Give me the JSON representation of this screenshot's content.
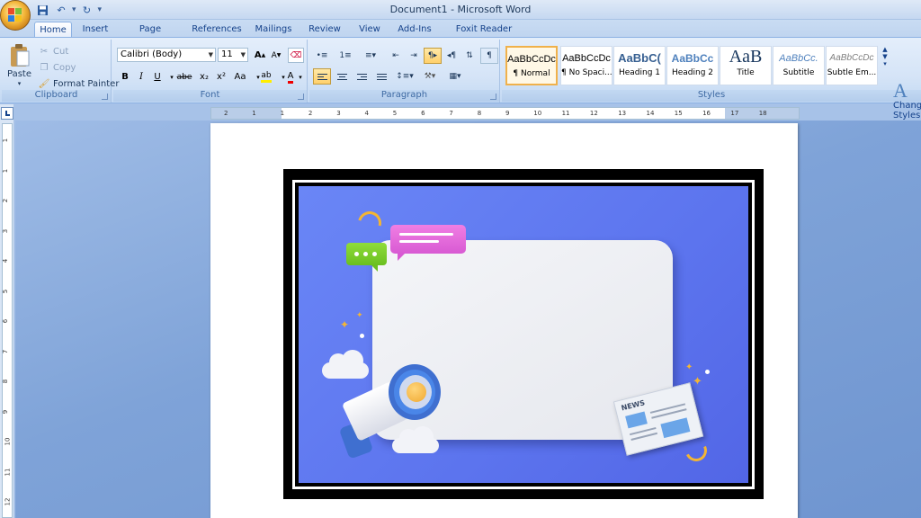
{
  "window": {
    "title": "Document1 - Microsoft Word"
  },
  "quick_access": {
    "save_icon": "save-icon",
    "undo_icon": "undo-icon",
    "redo_icon": "redo-icon"
  },
  "tabs": [
    {
      "label": "Home"
    },
    {
      "label": "Insert"
    },
    {
      "label": "Page Layout"
    },
    {
      "label": "References"
    },
    {
      "label": "Mailings"
    },
    {
      "label": "Review"
    },
    {
      "label": "View"
    },
    {
      "label": "Add-Ins"
    },
    {
      "label": "Foxit Reader PDF"
    }
  ],
  "clipboard": {
    "paste": "Paste",
    "cut": "Cut",
    "copy": "Copy",
    "format_painter": "Format Painter",
    "label": "Clipboard"
  },
  "font": {
    "family": "Calibri (Body)",
    "size": "11",
    "label": "Font",
    "buttons": [
      "B",
      "I",
      "U",
      "abe",
      "x₂",
      "x²",
      "Aa"
    ]
  },
  "paragraph": {
    "label": "Paragraph"
  },
  "styles": {
    "label": "Styles",
    "tiles": [
      {
        "sample": "AaBbCcDc",
        "name": "¶ Normal"
      },
      {
        "sample": "AaBbCcDc",
        "name": "¶ No Spaci..."
      },
      {
        "sample": "AaBbC(",
        "name": "Heading 1"
      },
      {
        "sample": "AaBbCc",
        "name": "Heading 2"
      },
      {
        "sample": "AaB",
        "name": "Title"
      },
      {
        "sample": "AaBbCc.",
        "name": "Subtitle"
      },
      {
        "sample": "AaBbCcDc",
        "name": "Subtle Em..."
      }
    ],
    "change_styles": "Change Styles"
  },
  "ruler": {
    "h_ticks": [
      "2",
      "1",
      "1",
      "2",
      "3",
      "4",
      "5",
      "6",
      "7",
      "8",
      "9",
      "10",
      "11",
      "12",
      "13",
      "14",
      "15",
      "16",
      "17",
      "18"
    ],
    "v_ticks": [
      "1",
      "1",
      "2",
      "3",
      "4",
      "5",
      "6",
      "7",
      "8",
      "9",
      "10",
      "11",
      "12"
    ]
  },
  "picture": {
    "news_header": "NEWS",
    "colors": {
      "background": "#5c74ee",
      "card": "#eceef3",
      "pink_bubble": "#e06ad8",
      "green_bubble": "#7ccc2c",
      "megaphone": "#4a86e8",
      "accent": "#f3b534"
    }
  }
}
